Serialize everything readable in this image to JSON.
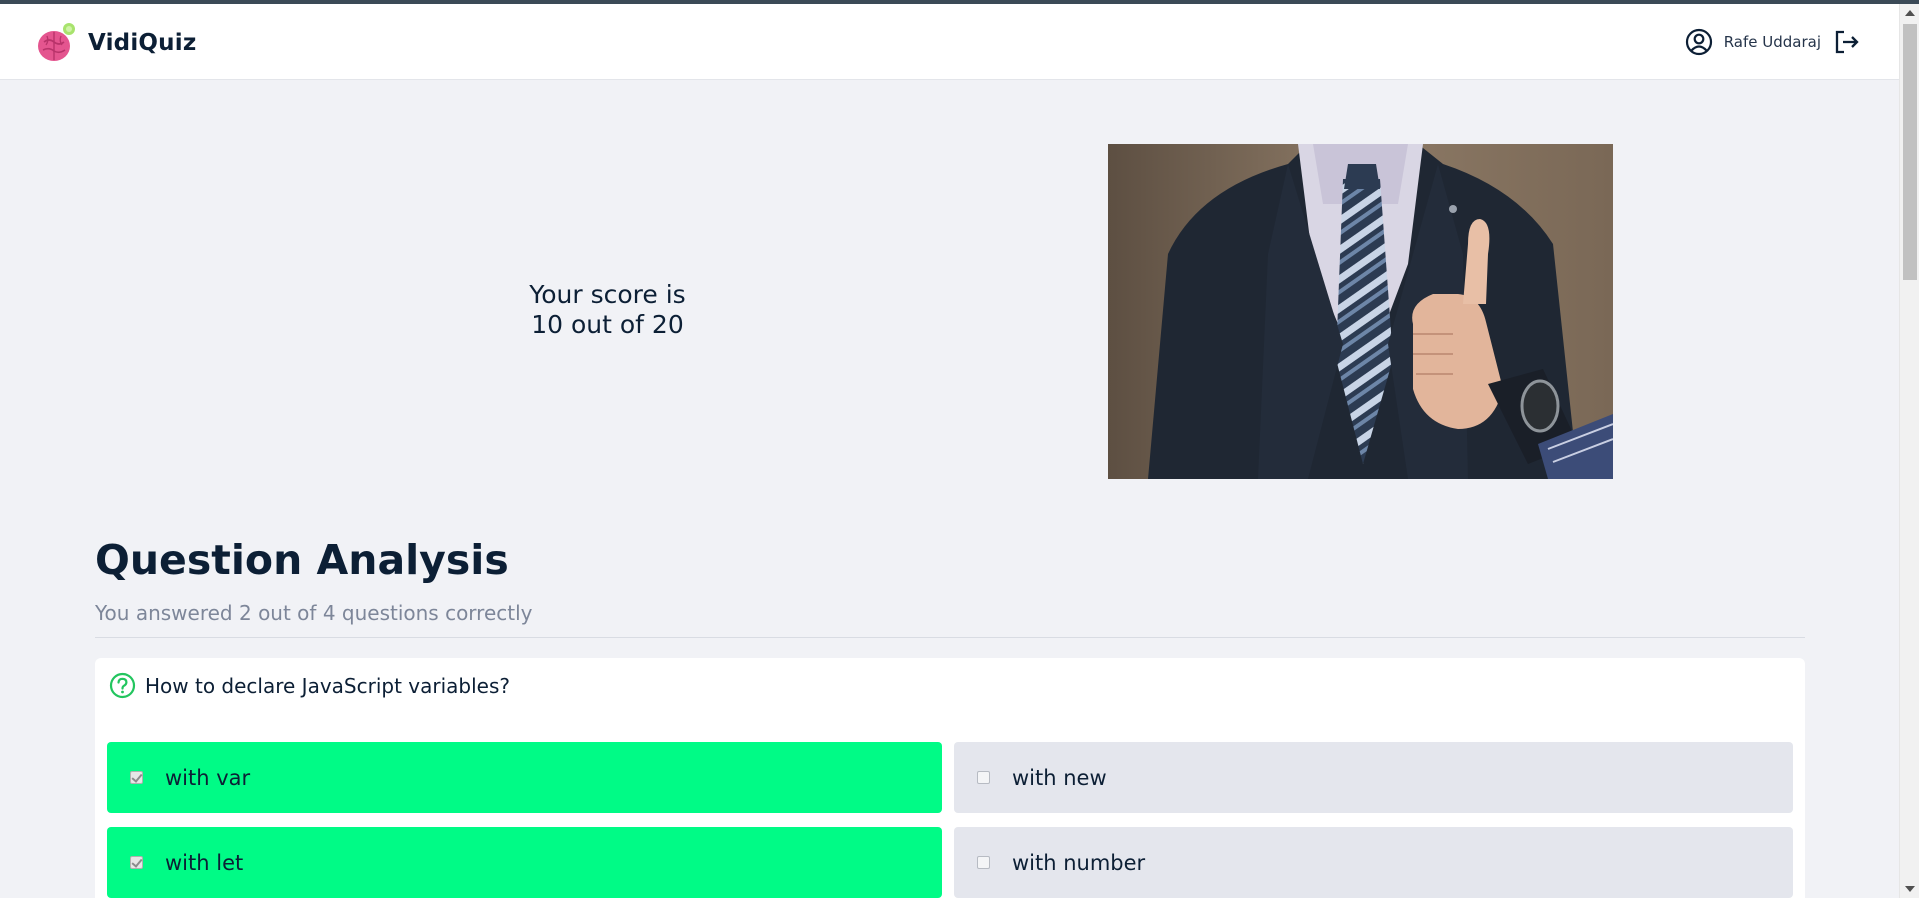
{
  "app": {
    "title": "VidiQuiz",
    "user_name": "Rafe Uddaraj"
  },
  "score": {
    "line1": "Your score is",
    "line2": "10 out of 20"
  },
  "analysis": {
    "title": "Question Analysis",
    "subtitle": "You answered 2 out of 4 questions correctly"
  },
  "question": {
    "text": "How to declare JavaScript variables?",
    "options": [
      {
        "label": "with var",
        "checked": true,
        "correct": true
      },
      {
        "label": "with new",
        "checked": false,
        "correct": false
      },
      {
        "label": "with let",
        "checked": true,
        "correct": true
      },
      {
        "label": "with number",
        "checked": false,
        "correct": false
      }
    ]
  },
  "colors": {
    "correct": "#00fb86",
    "neutral": "#e4e6ed",
    "text": "#0c1f35",
    "muted": "#7d8699",
    "question_icon": "#22c55e"
  },
  "icons": {
    "logo": "brain-logo-icon",
    "user": "user-circle-icon",
    "logout": "logout-icon",
    "question": "question-circle-icon"
  }
}
